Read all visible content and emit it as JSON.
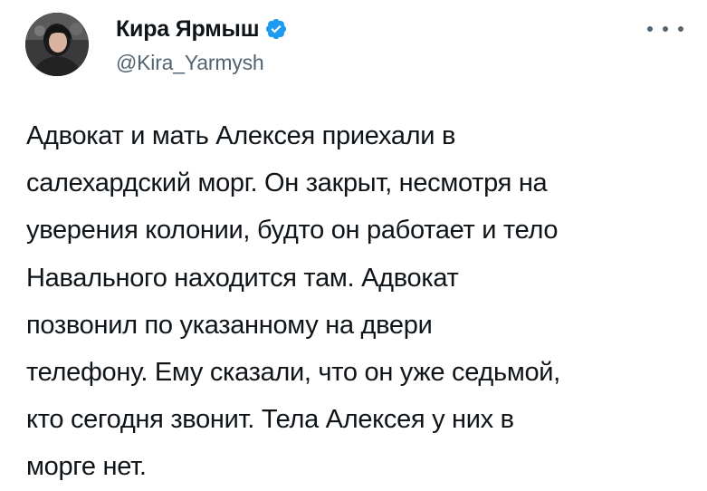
{
  "author": {
    "display_name": "Кира Ярмыш",
    "handle": "@Kira_Yarmysh",
    "verified": true,
    "verified_color": "#1d9bf0"
  },
  "icons": {
    "verified": "verified-badge-icon",
    "more": "more-options-icon"
  },
  "tweet": {
    "lines": [
      "Адвокат и мать Алексея приехали в",
      "салехардский морг. Он закрыт, несмотря на",
      "уверения колонии, будто он работает и тело",
      "Навального находится там. Адвокат",
      "позвонил по указанному на двери",
      "телефону. Ему сказали, что он уже седьмой,",
      "кто сегодня звонит. Тела Алексея у них в",
      "морге нет."
    ]
  }
}
